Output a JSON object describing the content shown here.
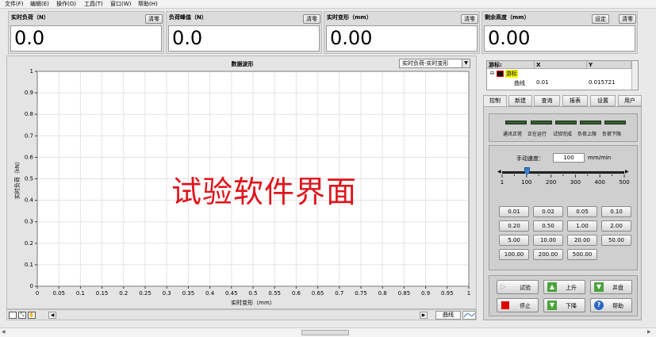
{
  "menu": [
    "文件(F)",
    "编辑(E)",
    "操作(O)",
    "工具(T)",
    "窗口(W)",
    "帮助(H)"
  ],
  "meters": [
    {
      "title": "实时负荷（N）",
      "value": "0.0",
      "buttons": [
        "清零"
      ]
    },
    {
      "title": "负荷峰值（N）",
      "value": "0.0",
      "buttons": [
        "清零"
      ]
    },
    {
      "title": "实时变形（mm）",
      "value": "0.00",
      "buttons": [
        "清零"
      ]
    },
    {
      "title": "剩余高度（mm）",
      "value": "0.00",
      "buttons": [
        "设定",
        "清零"
      ]
    }
  ],
  "chart": {
    "title": "数据波形",
    "selector_value": "实时负荷-实时变形"
  },
  "chart_data": {
    "type": "line",
    "title": "数据波形",
    "xlabel": "实时变形（mm）",
    "ylabel": "实时负荷（kN）",
    "xlim": [
      0,
      1
    ],
    "ylim": [
      0,
      1
    ],
    "x_ticks": [
      "0",
      "0.05",
      "0.1",
      "0.15",
      "0.2",
      "0.25",
      "0.3",
      "0.35",
      "0.4",
      "0.45",
      "0.5",
      "0.55",
      "0.6",
      "0.65",
      "0.7",
      "0.75",
      "0.8",
      "0.85",
      "0.9",
      "0.95",
      "1"
    ],
    "y_ticks": [
      "0",
      "0.1",
      "0.2",
      "0.3",
      "0.4",
      "0.5",
      "0.6",
      "0.7",
      "0.8",
      "0.9",
      "1"
    ],
    "grid": true,
    "series": []
  },
  "plot_toolbar": {
    "legend_label": "曲线"
  },
  "cursor_table": {
    "headers": [
      "游标:",
      "X",
      "Y"
    ],
    "cursor_name": "游标",
    "row": {
      "name": "曲线",
      "x": "0.01",
      "y": "0.015721"
    }
  },
  "tabs": [
    "控制",
    "新建",
    "查询",
    "报表",
    "设置",
    "用户"
  ],
  "active_tab": "控制",
  "leds": [
    "通讯正常",
    "正在运行",
    "试验完成",
    "负荷上限",
    "负荷下限"
  ],
  "speed": {
    "label": "手动速度：",
    "value": "100",
    "unit": "mm/min",
    "slider_ticks": [
      "1",
      "100",
      "200",
      "300",
      "400",
      "500"
    ],
    "slider_value": 100,
    "presets": [
      "0.01",
      "0.02",
      "0.05",
      "0.10",
      "0.20",
      "0.50",
      "1.00",
      "2.00",
      "5.00",
      "10.00",
      "20.00",
      "50.00",
      "100.00",
      "200.00",
      "500.00"
    ]
  },
  "actions": {
    "test": "试验",
    "up": "上升",
    "merge": "并盘",
    "stop": "停止",
    "down": "下降",
    "help": "帮助"
  },
  "overlay_text": "试验软件界面",
  "colors": {
    "accent_red": "#e0141c",
    "led_off": "#355b30",
    "cursor_yellow": "#f5f500"
  }
}
